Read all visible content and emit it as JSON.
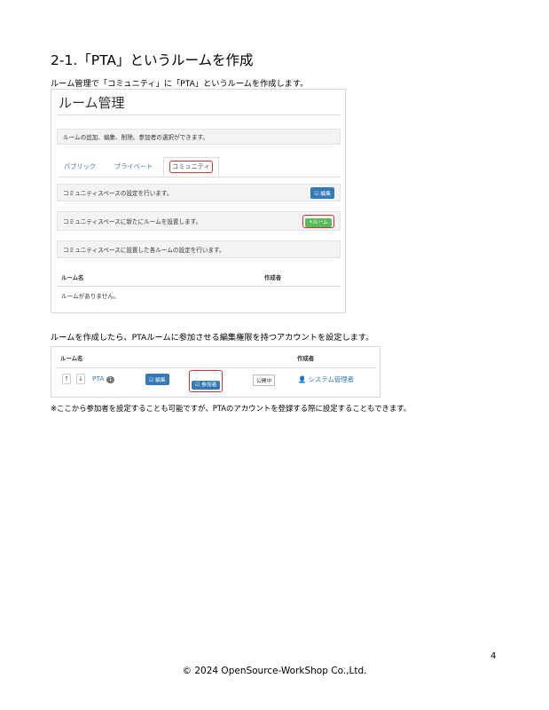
{
  "heading": "2-1.「PTA」というルームを作成",
  "para1": "ルーム管理で「コミュニティ」に「PTA」というルームを作成します。",
  "shot1": {
    "title": "ルーム管理",
    "info": "ルームの追加、編集、削除、参加者の選択ができます。",
    "tabs": [
      "パブリック",
      "プライベート",
      "コミュニティ"
    ],
    "row1": "コミュニティスペースの設定を行います。",
    "edit_btn": "編集",
    "row2": "コミュニティスペースに新たにルームを設置します。",
    "add_room_btn": "+ルーム",
    "row3": "コミュニティスペースに設置した各ルームの設定を行います。",
    "col_room": "ルーム名",
    "col_author": "作成者",
    "empty": "ルームがありません。"
  },
  "para2": "ルームを作成したら、PTAルームに参加させる編集権限を持つアカウントを設定します。",
  "shot2": {
    "col_room": "ルーム名",
    "col_author": "作成者",
    "room_name": "PTA",
    "badge": "1",
    "edit_btn": "編集",
    "participants_btn": "参加者",
    "status": "公開中",
    "author": "システム管理者",
    "up": "↑",
    "down": "↓"
  },
  "note": "※ここから参加者を設定することも可能ですが、PTAのアカウントを登録する際に設定することもできます。",
  "page_number": "4",
  "footer": "© 2024 OpenSource-WorkShop Co.,Ltd.",
  "colors": {
    "primary": "#337ab7",
    "success": "#5cb85c",
    "highlight": "#d9302c"
  }
}
